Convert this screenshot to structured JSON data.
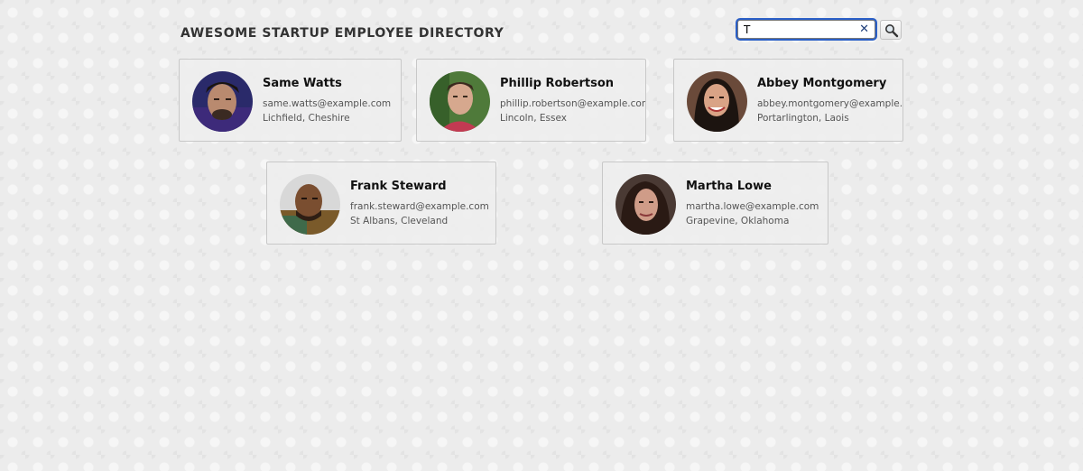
{
  "header": {
    "title": "AWESOME STARTUP EMPLOYEE DIRECTORY"
  },
  "search": {
    "value": "T",
    "clear_icon": "close-icon",
    "button_icon": "search-icon"
  },
  "employees": [
    {
      "name": "Same Watts",
      "email": "same.watts@example.com",
      "location": "Lichfield, Cheshire"
    },
    {
      "name": "Phillip Robertson",
      "email": "phillip.robertson@example.com",
      "location": "Lincoln, Essex"
    },
    {
      "name": "Abbey Montgomery",
      "email": "abbey.montgomery@example.com",
      "location": "Portarlington, Laois"
    },
    {
      "name": "Frank Steward",
      "email": "frank.steward@example.com",
      "location": "St Albans, Cleveland"
    },
    {
      "name": "Martha Lowe",
      "email": "martha.lowe@example.com",
      "location": "Grapevine, Oklahoma"
    }
  ]
}
